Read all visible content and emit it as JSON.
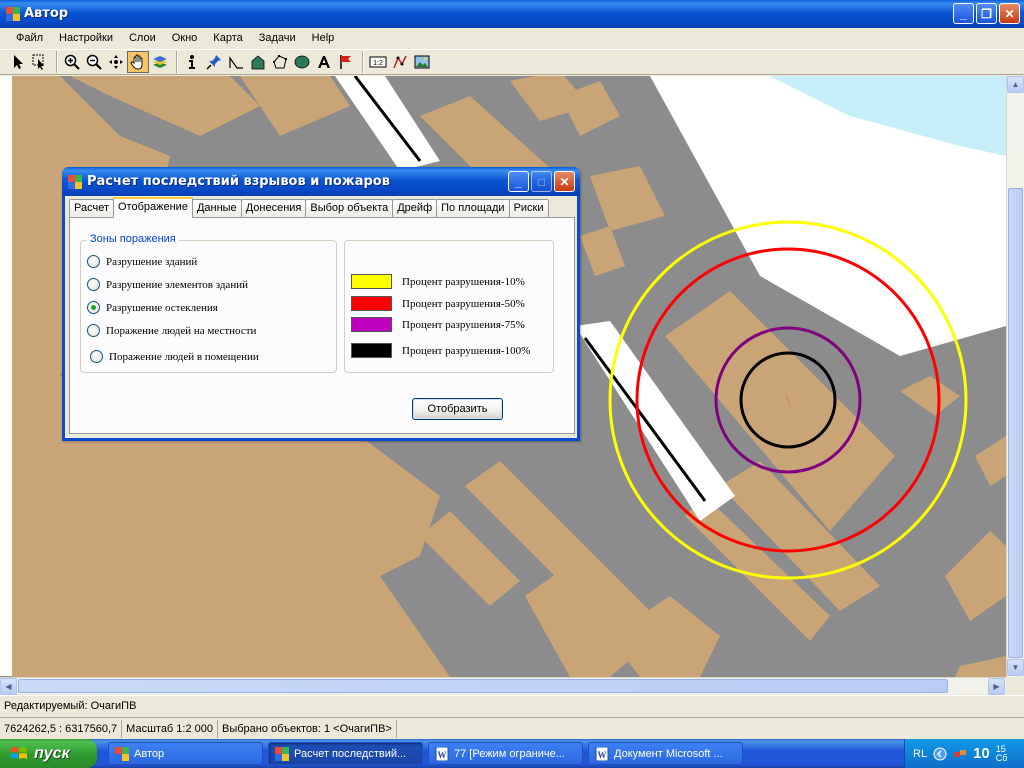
{
  "window": {
    "title": "Автор",
    "buttons": {
      "minimize": "_",
      "maximize": "❐",
      "close": "✕"
    }
  },
  "menu": {
    "items": [
      "Файл",
      "Настройки",
      "Слои",
      "Окно",
      "Карта",
      "Задачи",
      "Help"
    ]
  },
  "toolbar": {
    "tools": [
      "select-arrow-icon",
      "select-region-icon",
      "zoom-in-icon",
      "zoom-out-icon",
      "pan-move-icon",
      "hand-icon",
      "layers-icon",
      "info-icon",
      "pin-icon",
      "polyline-icon",
      "polygon-icon",
      "freeform-polygon-icon",
      "ellipse-icon",
      "text-icon",
      "flag-icon",
      "scale-ruler-icon",
      "query-icon",
      "image-icon"
    ],
    "active_tool": "hand-icon",
    "ruler_text": "1:2"
  },
  "dialog": {
    "title": "Расчет последствий взрывов и пожаров",
    "tabs": [
      "Расчет",
      "Отображение",
      "Данные",
      "Донесения",
      "Выбор объекта",
      "Дрейф",
      "По площади",
      "Риски"
    ],
    "selected_tab": "Отображение",
    "zones_group": {
      "title": "Зоны поражения",
      "options": [
        {
          "label": "Разрушение зданий",
          "checked": false
        },
        {
          "label": "Разрушение элементов зданий",
          "checked": false
        },
        {
          "label": "Разрушение остекления",
          "checked": true
        },
        {
          "label": "Поражение людей на местности",
          "checked": false
        },
        {
          "label": "Поражение людей в помещении",
          "checked": false
        }
      ]
    },
    "legend": [
      {
        "label": "Процент разрушения-10%",
        "color": "#ffff00"
      },
      {
        "label": "Процент разрушения-50%",
        "color": "#ff0000"
      },
      {
        "label": "Процент разрушения-75%",
        "color": "#c000c0"
      },
      {
        "label": "Процент разрушения-100%",
        "color": "#000000"
      }
    ],
    "show_button": "Отобразить"
  },
  "map": {
    "colors": {
      "ground": "#8c8c8c",
      "building": "#c8a477",
      "road": "#ffffff",
      "water": "#c5eef8"
    },
    "zones": [
      {
        "level": "10%",
        "color": "#ffff00"
      },
      {
        "level": "50%",
        "color": "#ff0000"
      },
      {
        "level": "75%",
        "color": "#800080"
      },
      {
        "level": "100%",
        "color": "#000000"
      }
    ]
  },
  "status": {
    "editable": "Редактируемый: ОчагиПВ",
    "coords": "7624262,5 : 6317560,7",
    "scale": "Масштаб 1:2 000",
    "selected": "Выбрано объектов: 1 <ОчагиПВ>"
  },
  "taskbar": {
    "start": "пуск",
    "tasks": [
      {
        "label": "Автор",
        "active": false
      },
      {
        "label": "Расчет последствий...",
        "active": true
      },
      {
        "label": "77 [Режим ограниче...",
        "active": false
      },
      {
        "label": "Документ Microsoft ...",
        "active": false
      }
    ],
    "tray": {
      "lang": "RL",
      "time_hour": "10",
      "time_min": "15",
      "time_suffix": "Сб"
    }
  }
}
